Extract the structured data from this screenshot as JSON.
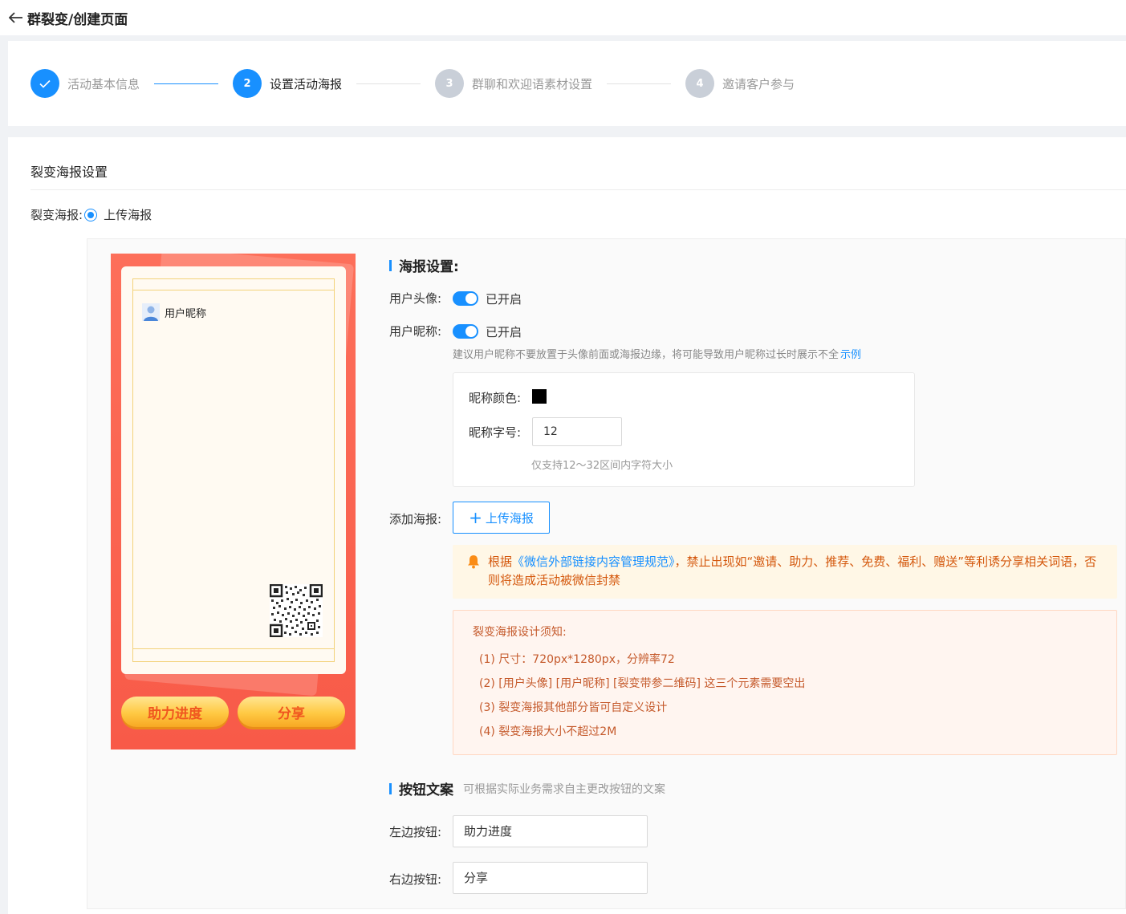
{
  "header": {
    "title": "群裂变/创建页面"
  },
  "steps": [
    {
      "number": "1",
      "label": "活动基本信息",
      "status": "done"
    },
    {
      "number": "2",
      "label": "设置活动海报",
      "status": "active"
    },
    {
      "number": "3",
      "label": "群聊和欢迎语素材设置",
      "status": "wait"
    },
    {
      "number": "4",
      "label": "邀请客户参与",
      "status": "wait"
    }
  ],
  "section": {
    "title": "裂变海报设置",
    "poster_type_label": "裂变海报:",
    "poster_type_option": "上传海报"
  },
  "preview": {
    "nickname": "用户昵称",
    "left_button": "助力进度",
    "right_button": "分享"
  },
  "poster_settings": {
    "heading": "海报设置:",
    "avatar_label": "用户头像:",
    "avatar_status": "已开启",
    "nickname_label": "用户昵称:",
    "nickname_status": "已开启",
    "hint": "建议用户昵称不要放置于头像前面或海报边缘，将可能导致用户昵称过长时展示不全",
    "hint_link": "示例",
    "nick_color_label": "昵称颜色:",
    "nick_color": "#000000",
    "nick_size_label": "昵称字号:",
    "nick_size_value": "12",
    "nick_size_hint": "仅支持12～32区间内字符大小",
    "add_poster_label": "添加海报:",
    "upload_button": "上传海报"
  },
  "warning": {
    "prefix": "根据",
    "link": "《微信外部链接内容管理规范》",
    "text": "，禁止出现如“邀请、助力、推荐、免费、福利、赠送”等利诱分享相关词语，否则将造成活动被微信封禁"
  },
  "tips": {
    "title": "裂变海报设计须知:",
    "items": [
      "(1) 尺寸：720px*1280px，分辨率72",
      "(2) [用户头像] [用户昵称] [裂变带参二维码] 这三个元素需要空出",
      "(3) 裂变海报其他部分皆可自定义设计",
      "(4) 裂变海报大小不超过2M"
    ]
  },
  "button_copy": {
    "heading": "按钮文案",
    "subheading": "可根据实际业务需求自主更改按钮的文案",
    "left_label": "左边按钮:",
    "left_value": "助力进度",
    "right_label": "右边按钮:",
    "right_value": "分享"
  },
  "colors": {
    "primary": "#1890ff",
    "poster_bg": "#f85a48",
    "warning_text": "#d4580d"
  }
}
